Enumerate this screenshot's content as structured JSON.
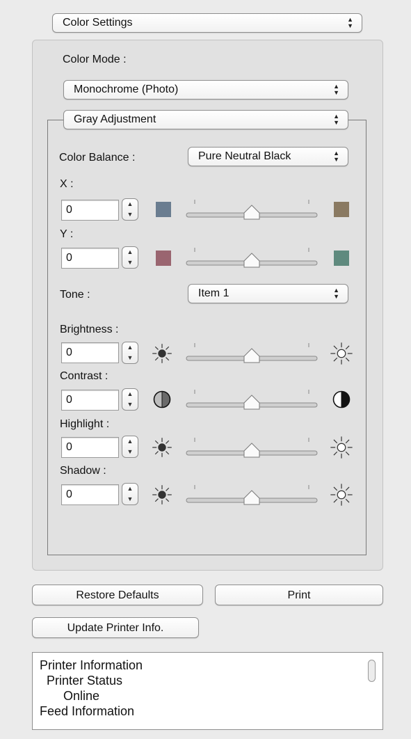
{
  "settings_popup": {
    "label": "Color Settings"
  },
  "color_mode": {
    "label": "Color Mode :",
    "value": "Monochrome (Photo)"
  },
  "gray_adjustment": {
    "label": "Gray Adjustment"
  },
  "color_balance": {
    "label": "Color Balance :",
    "value": "Pure Neutral Black"
  },
  "x_adjust": {
    "label": "X :",
    "value": "0",
    "slider_value": 0,
    "left_color": "#6a7d90",
    "right_color": "#8a7a62"
  },
  "y_adjust": {
    "label": "Y :",
    "value": "0",
    "slider_value": 0,
    "left_color": "#9a6570",
    "right_color": "#5f8a7e"
  },
  "tone": {
    "label": "Tone :",
    "value": "Item 1"
  },
  "brightness": {
    "label": "Brightness :",
    "value": "0",
    "slider_value": 0,
    "left_icon": "sun-dark-icon",
    "right_icon": "sun-light-icon"
  },
  "contrast": {
    "label": "Contrast :",
    "value": "0",
    "slider_value": 0,
    "left_icon": "contrast-low-icon",
    "right_icon": "contrast-high-icon"
  },
  "highlight": {
    "label": "Highlight :",
    "value": "0",
    "slider_value": 0,
    "left_icon": "sun-dark-icon",
    "right_icon": "sun-light-icon"
  },
  "shadow": {
    "label": "Shadow :",
    "value": "0",
    "slider_value": 0,
    "left_icon": "sun-dark-icon",
    "right_icon": "sun-light-icon"
  },
  "buttons": {
    "restore_defaults": "Restore Defaults",
    "print": "Print",
    "update_printer_info": "Update Printer Info."
  },
  "printer_info": {
    "lines": [
      "Printer Information",
      "Printer Status",
      "Online",
      "Feed Information"
    ]
  }
}
